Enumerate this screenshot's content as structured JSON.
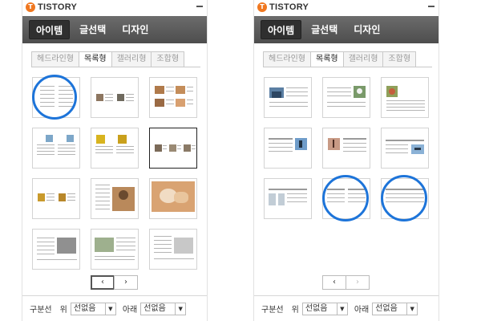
{
  "brand": {
    "logo_text": "TISTORY",
    "logo_mark": "T"
  },
  "nav": {
    "items": [
      "아이템",
      "글선택",
      "디자인"
    ],
    "active_index": 0
  },
  "subtabs": {
    "items": [
      "헤드라인형",
      "목록형",
      "갤러리형",
      "조합형"
    ],
    "active_index": 1
  },
  "pager": {
    "prev": "‹",
    "next": "›"
  },
  "footer": {
    "label": "구분선",
    "top_label": "위",
    "top_value": "선없음",
    "bottom_label": "아래",
    "bottom_value": "선없음",
    "arrow_glyph": "▼"
  },
  "colors": {
    "highlight_circle": "#1d74d9",
    "navbar": "#5a5a5a",
    "logo": "#f0771f"
  },
  "icons": [
    "tistory-logo-icon",
    "minimize-icon",
    "chevron-left-icon",
    "chevron-right-icon",
    "dropdown-arrow-icon"
  ]
}
